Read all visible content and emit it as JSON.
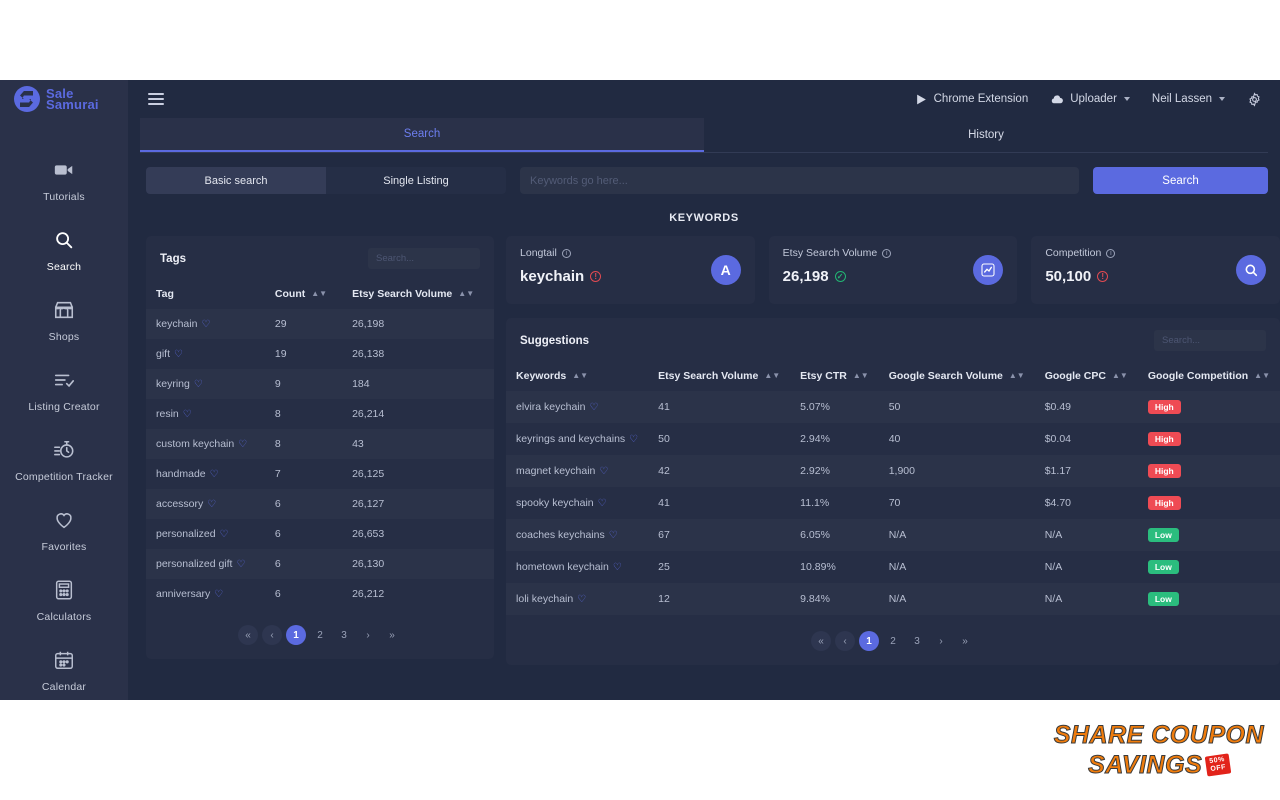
{
  "brand": {
    "name_line1": "Sale",
    "name_line2": "Samurai",
    "accent": "#5b6ae0"
  },
  "sidebar": {
    "items": [
      {
        "label": "Tutorials",
        "icon": "video-icon",
        "active": false
      },
      {
        "label": "Search",
        "icon": "search-icon",
        "active": true
      },
      {
        "label": "Shops",
        "icon": "shop-icon",
        "active": false
      },
      {
        "label": "Listing Creator",
        "icon": "list-check-icon",
        "active": false
      },
      {
        "label": "Competition Tracker",
        "icon": "stopwatch-icon",
        "active": false
      },
      {
        "label": "Favorites",
        "icon": "heart-icon",
        "active": false
      },
      {
        "label": "Calculators",
        "icon": "calculator-icon",
        "active": false
      },
      {
        "label": "Calendar",
        "icon": "calendar-icon",
        "active": false
      }
    ]
  },
  "topbar": {
    "chrome_extension": "Chrome Extension",
    "uploader": "Uploader",
    "user": "Neil Lassen"
  },
  "tabs": [
    {
      "label": "Search",
      "active": true
    },
    {
      "label": "History",
      "active": false
    }
  ],
  "search": {
    "modes": [
      {
        "label": "Basic search",
        "active": true
      },
      {
        "label": "Single Listing",
        "active": false
      }
    ],
    "placeholder": "Keywords go here...",
    "value": "",
    "button": "Search"
  },
  "section_title": "KEYWORDS",
  "tags_panel": {
    "title": "Tags",
    "search_placeholder": "Search...",
    "columns": [
      "Tag",
      "Count",
      "Etsy Search Volume"
    ],
    "rows": [
      {
        "tag": "keychain",
        "count": "29",
        "volume": "26,198"
      },
      {
        "tag": "gift",
        "count": "19",
        "volume": "26,138"
      },
      {
        "tag": "keyring",
        "count": "9",
        "volume": "184"
      },
      {
        "tag": "resin",
        "count": "8",
        "volume": "26,214"
      },
      {
        "tag": "custom keychain",
        "count": "8",
        "volume": "43"
      },
      {
        "tag": "handmade",
        "count": "7",
        "volume": "26,125"
      },
      {
        "tag": "accessory",
        "count": "6",
        "volume": "26,127"
      },
      {
        "tag": "personalized",
        "count": "6",
        "volume": "26,653"
      },
      {
        "tag": "personalized gift",
        "count": "6",
        "volume": "26,130"
      },
      {
        "tag": "anniversary",
        "count": "6",
        "volume": "26,212"
      }
    ],
    "pagination": {
      "pages": [
        "1",
        "2",
        "3"
      ],
      "current": "1"
    }
  },
  "cards": [
    {
      "label": "Longtail",
      "value": "keychain",
      "icon": "letter-a-icon",
      "status": "alert"
    },
    {
      "label": "Etsy Search Volume",
      "value": "26,198",
      "icon": "chart-line-icon",
      "status": "ok"
    },
    {
      "label": "Competition",
      "value": "50,100",
      "icon": "magnifier-icon",
      "status": "alert"
    }
  ],
  "suggestions_panel": {
    "title": "Suggestions",
    "search_placeholder": "Search...",
    "columns": [
      "Keywords",
      "Etsy Search Volume",
      "Etsy CTR",
      "Google Search Volume",
      "Google CPC",
      "Google Competition"
    ],
    "rows": [
      {
        "keyword": "elvira keychain",
        "esv": "41",
        "ctr": "5.07%",
        "gsv": "50",
        "cpc": "$0.49",
        "comp": "High"
      },
      {
        "keyword": "keyrings and keychains",
        "esv": "50",
        "ctr": "2.94%",
        "gsv": "40",
        "cpc": "$0.04",
        "comp": "High"
      },
      {
        "keyword": "magnet keychain",
        "esv": "42",
        "ctr": "2.92%",
        "gsv": "1,900",
        "cpc": "$1.17",
        "comp": "High"
      },
      {
        "keyword": "spooky keychain",
        "esv": "41",
        "ctr": "11.1%",
        "gsv": "70",
        "cpc": "$4.70",
        "comp": "High"
      },
      {
        "keyword": "coaches keychains",
        "esv": "67",
        "ctr": "6.05%",
        "gsv": "N/A",
        "cpc": "N/A",
        "comp": "Low"
      },
      {
        "keyword": "hometown keychain",
        "esv": "25",
        "ctr": "10.89%",
        "gsv": "N/A",
        "cpc": "N/A",
        "comp": "Low"
      },
      {
        "keyword": "loli keychain",
        "esv": "12",
        "ctr": "9.84%",
        "gsv": "N/A",
        "cpc": "N/A",
        "comp": "Low"
      }
    ],
    "pagination": {
      "pages": [
        "1",
        "2",
        "3"
      ],
      "current": "1"
    }
  },
  "watermark": {
    "line1": "SHARE COUPON",
    "line2": "SAVINGS",
    "tag_line1": "50%",
    "tag_line2": "OFF"
  }
}
